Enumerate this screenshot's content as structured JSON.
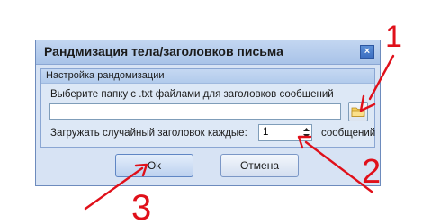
{
  "dialog": {
    "title": "Рандмизация тела/заголовков письма",
    "close_label": "×"
  },
  "group": {
    "title": "Настройка рандомизации",
    "folder_label": "Выберите папку с .txt файлами для заголовков сообщений",
    "folder_value": "",
    "load_label": "Загружать случайный заголовок каждые:",
    "interval_value": "1",
    "interval_suffix": "сообщений"
  },
  "buttons": {
    "ok_label": "Ok",
    "cancel_label": "Отмена"
  },
  "annotations": {
    "marker_1": "1",
    "marker_2": "2",
    "marker_3": "3",
    "color": "#e0101a"
  },
  "icons": {
    "browse": "folder-icon",
    "close": "close-icon",
    "spin": "spin-arrows-icon"
  }
}
